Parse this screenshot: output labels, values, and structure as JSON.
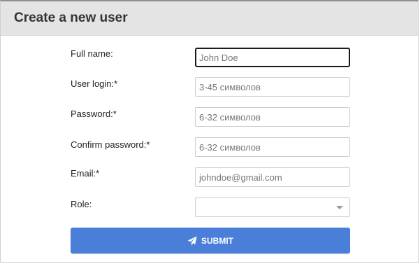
{
  "dialog": {
    "title": "Create a new user"
  },
  "form": {
    "full_name": {
      "label": "Full name:",
      "placeholder": "John Doe"
    },
    "user_login": {
      "label": "User login:*",
      "placeholder": "3-45 символов"
    },
    "password": {
      "label": "Password:*",
      "placeholder": "6-32 символов"
    },
    "confirm_password": {
      "label": "Confirm password:*",
      "placeholder": "6-32 символов"
    },
    "email": {
      "label": "Email:*",
      "placeholder": "johndoe@gmail.com"
    },
    "role": {
      "label": "Role:",
      "selected": ""
    }
  },
  "submit": {
    "label": "SUBMIT",
    "icon": "paper-plane-icon",
    "color": "#4a7fd9"
  }
}
